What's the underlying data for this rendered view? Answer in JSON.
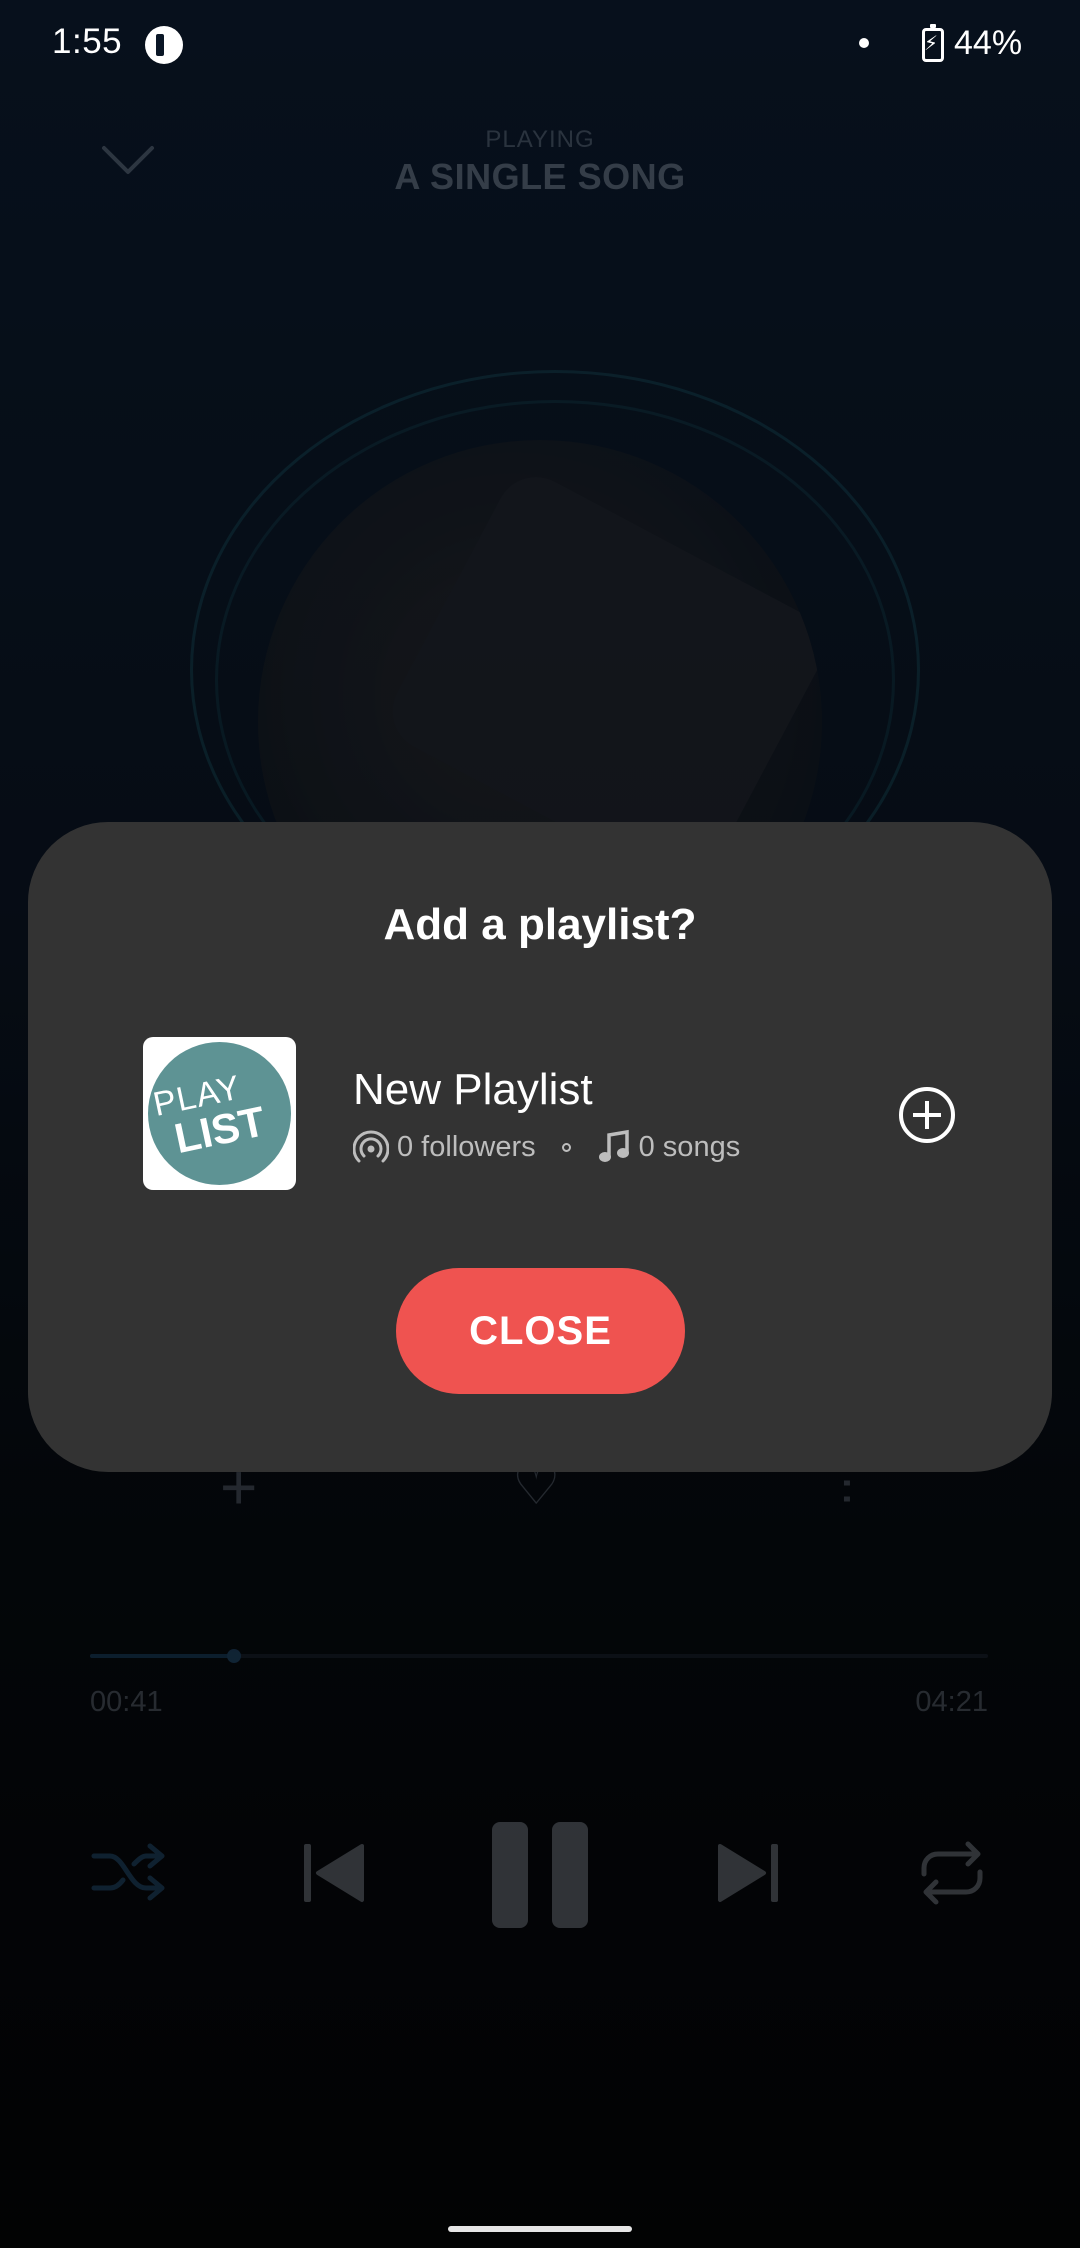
{
  "status_bar": {
    "time": "1:55",
    "battery": "44%"
  },
  "player": {
    "header_label": "PLAYING",
    "title": "A SINGLE SONG",
    "elapsed": "00:41",
    "total": "04:21",
    "progress": 0.16
  },
  "dialog": {
    "title": "Add a playlist?",
    "playlist": {
      "name": "New Playlist",
      "followers": "0 followers",
      "songs": "0 songs",
      "thumb_line1": "PLAY",
      "thumb_line2": "LIST"
    },
    "close_label": "CLOSE"
  },
  "colors": {
    "accent": "#ef5350",
    "dialog_bg": "#333333",
    "thumb_bg": "#5e9394"
  }
}
